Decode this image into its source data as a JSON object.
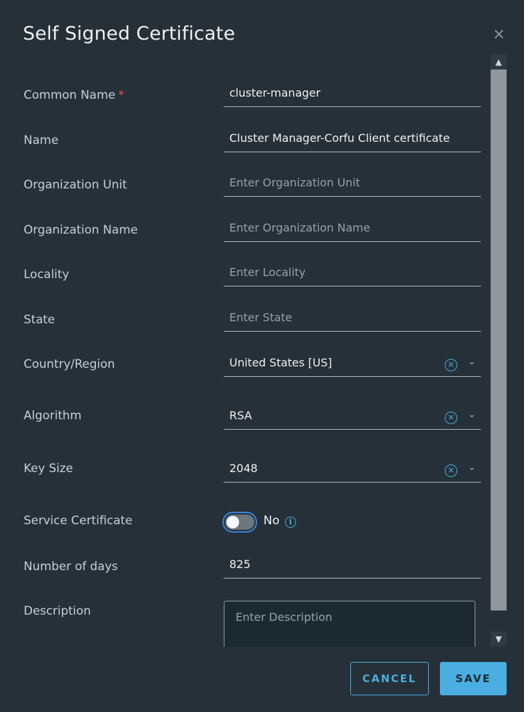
{
  "dialog": {
    "title": "Self Signed Certificate",
    "close_icon": "×"
  },
  "fields": [
    {
      "label": "Common Name",
      "required_mark": "*",
      "value": "cluster-manager",
      "placeholder": ""
    },
    {
      "label": "Name",
      "value": "Cluster Manager-Corfu Client certificate",
      "placeholder": ""
    },
    {
      "label": "Organization Unit",
      "value": "",
      "placeholder": "Enter Organization Unit"
    },
    {
      "label": "Organization Name",
      "value": "",
      "placeholder": "Enter Organization Name"
    },
    {
      "label": "Locality",
      "value": "",
      "placeholder": "Enter Locality"
    },
    {
      "label": "State",
      "value": "",
      "placeholder": "Enter State"
    }
  ],
  "selects": [
    {
      "label": "Country/Region",
      "value": "United States [US]"
    },
    {
      "label": "Algorithm",
      "value": "RSA"
    },
    {
      "label": "Key Size",
      "value": "2048"
    }
  ],
  "service_certificate": {
    "label": "Service Certificate",
    "state_text": "No",
    "enabled": false
  },
  "number_of_days": {
    "label": "Number of days",
    "value": "825"
  },
  "description": {
    "label": "Description",
    "placeholder": "Enter Description"
  },
  "buttons": {
    "cancel": "CANCEL",
    "save": "SAVE"
  },
  "colors": {
    "background": "#253039",
    "accent": "#49afd9",
    "primary_button": "#4aaee0",
    "required": "#e0554b"
  }
}
